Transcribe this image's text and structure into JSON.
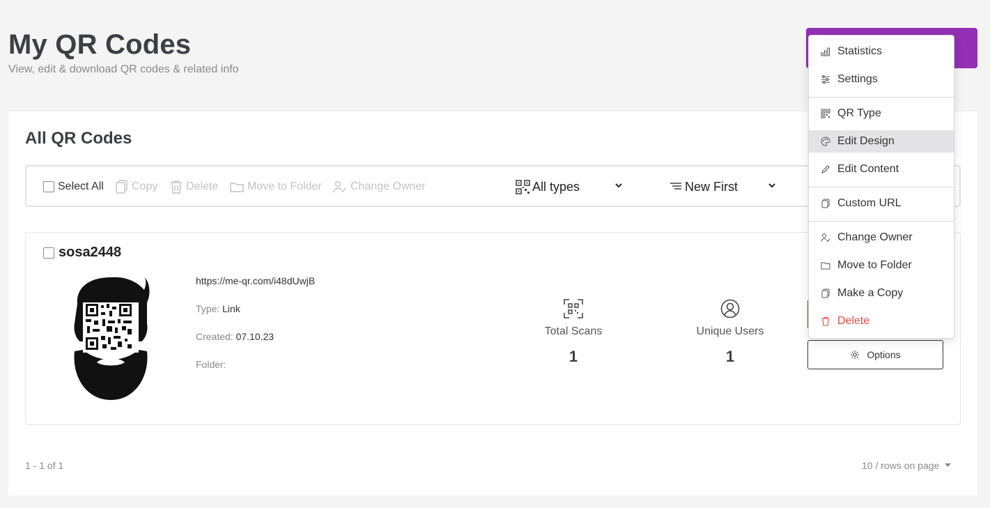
{
  "header": {
    "title": "My QR Codes",
    "subtitle": "View, edit & download QR codes & related info"
  },
  "colors": {
    "accent": "#9330b5",
    "danger": "#e04a3f",
    "muted": "#c4c4c4"
  },
  "list": {
    "title": "All QR Codes",
    "toolbar": {
      "select_all": "Select All",
      "copy": "Copy",
      "delete": "Delete",
      "move_to_folder": "Move to Folder",
      "change_owner": "Change Owner",
      "type_filter": "All types",
      "sort": "New First"
    },
    "items": [
      {
        "name": "sosa2448",
        "url": "https://me-qr.com/i48dUwjB",
        "type_label": "Type:",
        "type": "Link",
        "created_label": "Created:",
        "created": "07.10.23",
        "folder_label": "Folder:",
        "folder": "",
        "total_scans_label": "Total Scans",
        "total_scans": "1",
        "unique_users_label": "Unique Users",
        "unique_users": "1",
        "options_label": "Options"
      }
    ],
    "pagination": {
      "range": "1 - 1 of 1",
      "rows_per_page": "10 / rows on page"
    }
  },
  "menu": {
    "items": [
      {
        "label": "Statistics",
        "icon": "bar-chart-icon"
      },
      {
        "label": "Settings",
        "icon": "sliders-icon"
      },
      {
        "label": "QR Type",
        "icon": "qr-icon"
      },
      {
        "label": "Edit Design",
        "icon": "palette-icon",
        "highlighted": true
      },
      {
        "label": "Edit Content",
        "icon": "pencil-icon"
      },
      {
        "label": "Custom URL",
        "icon": "copy-icon"
      },
      {
        "label": "Change Owner",
        "icon": "user-check-icon"
      },
      {
        "label": "Move to Folder",
        "icon": "folder-icon"
      },
      {
        "label": "Make a Copy",
        "icon": "copy-icon"
      },
      {
        "label": "Delete",
        "icon": "trash-icon",
        "danger": true
      }
    ]
  }
}
